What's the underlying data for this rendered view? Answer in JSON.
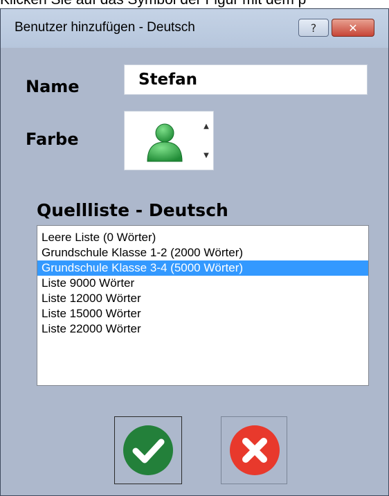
{
  "background_caption": "Klicken Sie auf das Symbol der Figur mit dem p",
  "window": {
    "title": "Benutzer hinzufügen - Deutsch",
    "help_label": "?",
    "close_label": "✕"
  },
  "form": {
    "name_label": "Name",
    "name_value": "Stefan",
    "color_label": "Farbe",
    "color_icon": "person-icon",
    "color_value": "#2e9e44"
  },
  "source_list": {
    "label": "Quellliste - Deutsch",
    "items": [
      "Leere Liste (0 Wörter)",
      "Grundschule Klasse 1-2 (2000 Wörter)",
      "Grundschule Klasse 3-4 (5000 Wörter)",
      "Liste 9000 Wörter",
      "Liste 12000 Wörter",
      "Liste 15000 Wörter",
      "Liste 22000 Wörter"
    ],
    "selected": "Grundschule Klasse 3-4 (5000 Wörter)"
  },
  "buttons": {
    "ok_icon": "checkmark-icon",
    "ok_color": "#23803a",
    "cancel_icon": "x-icon",
    "cancel_color": "#e8392c"
  }
}
